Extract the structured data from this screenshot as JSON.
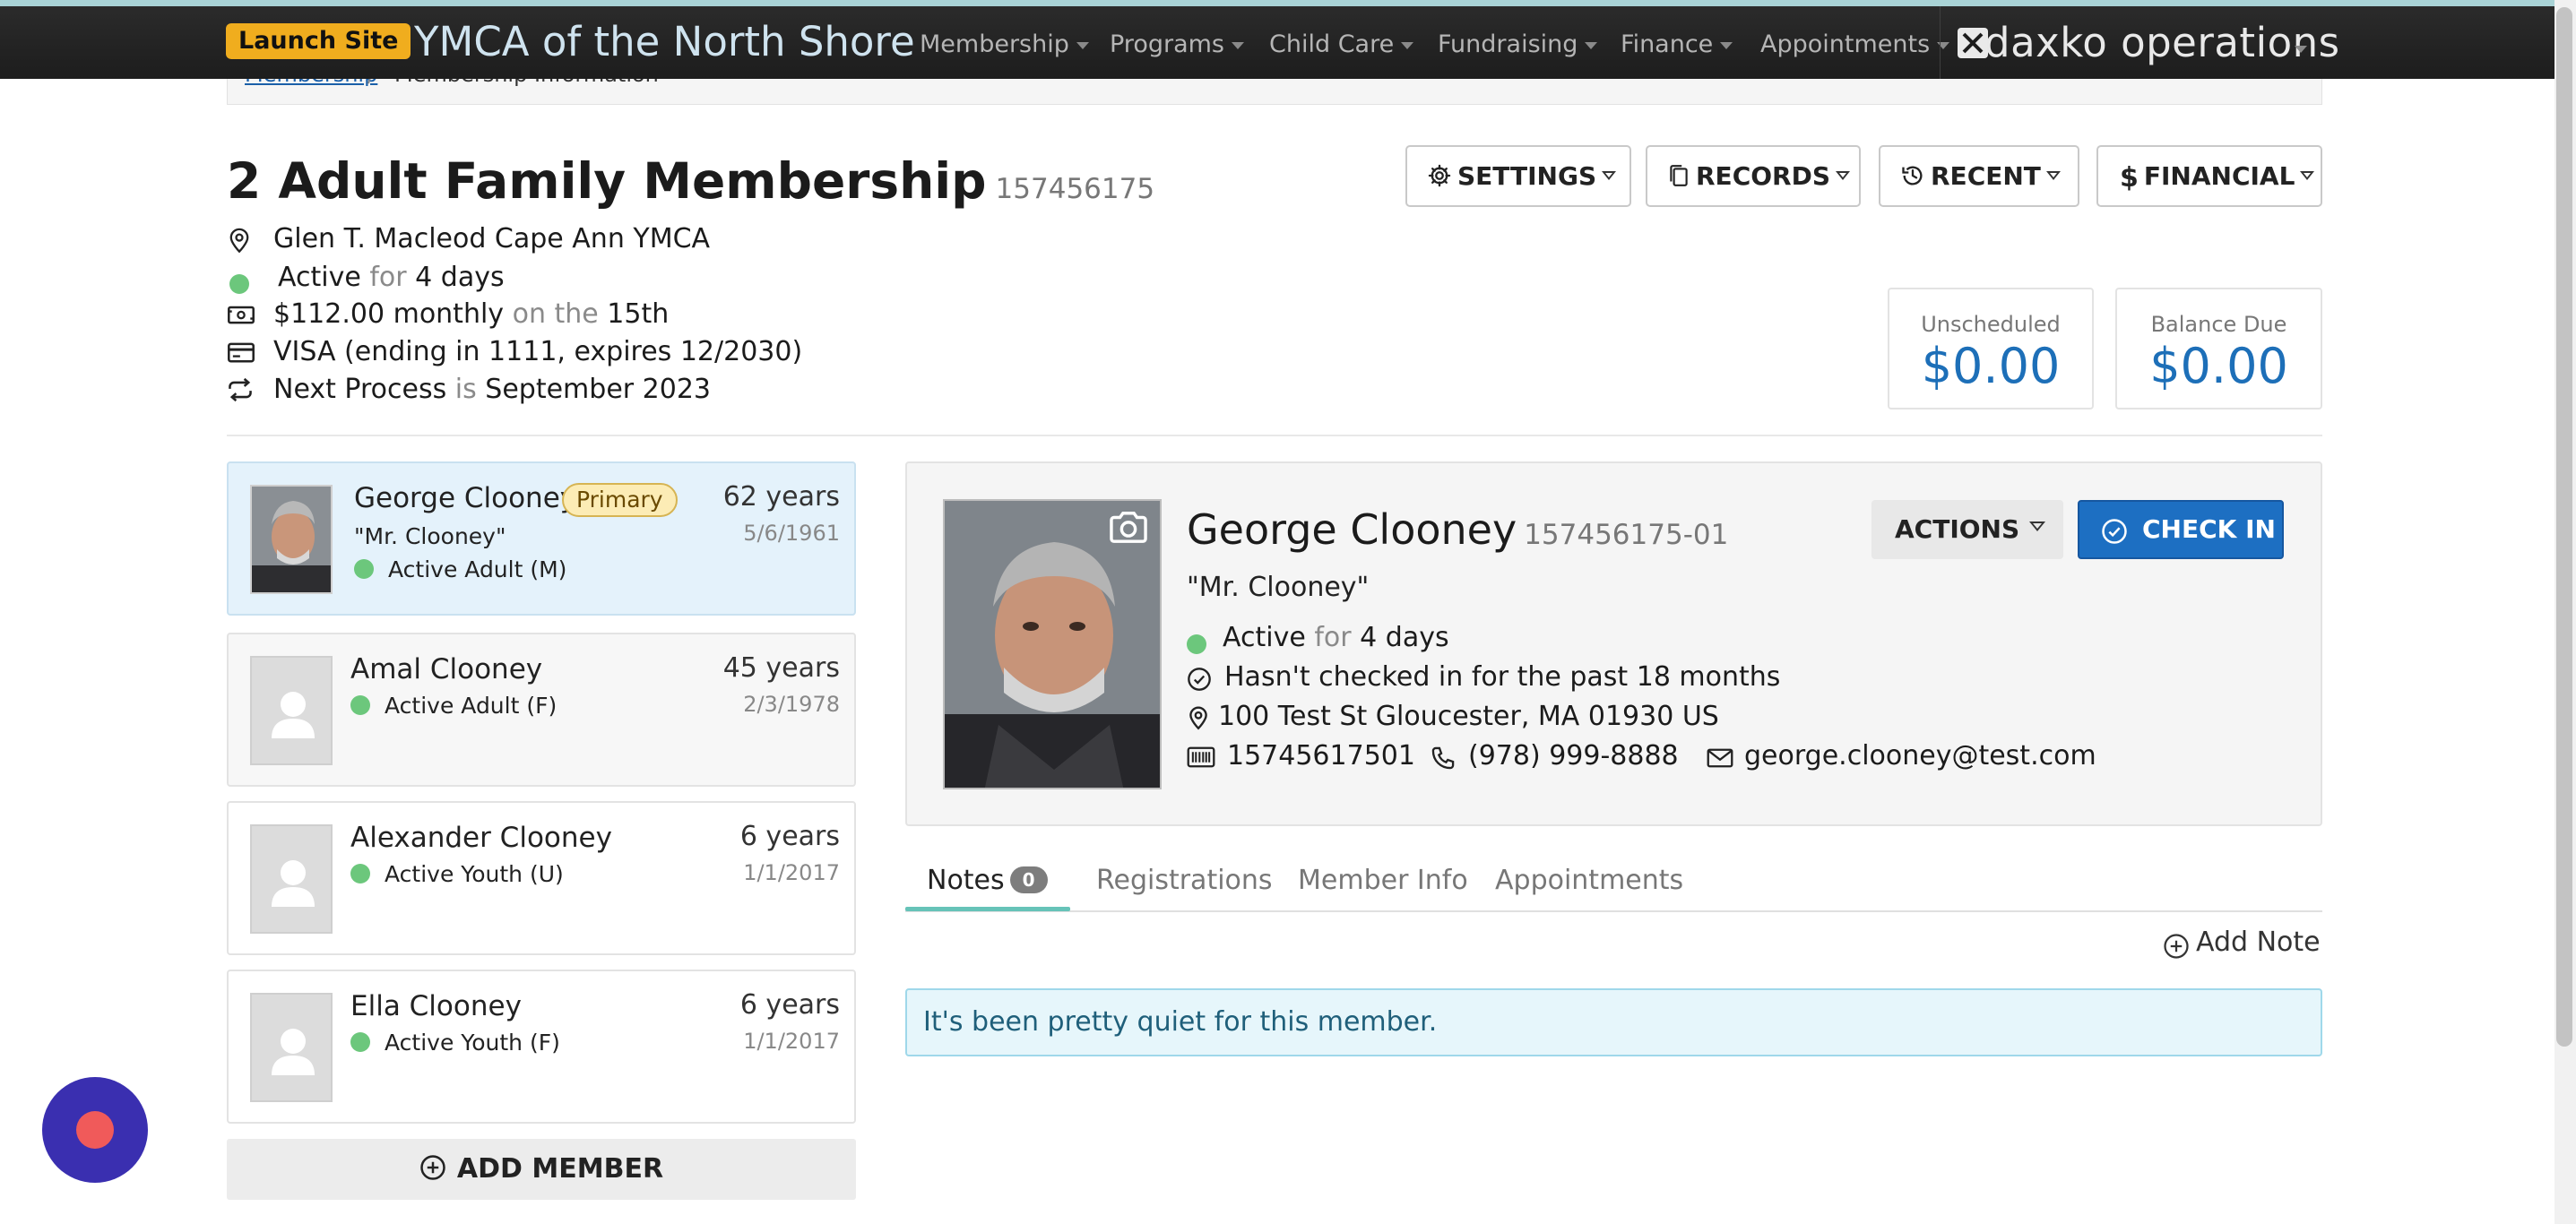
{
  "nav": {
    "launch_label": "Launch Site",
    "org_name": "YMCA of the North Shore",
    "menu": [
      "Membership",
      "Programs",
      "Child Care",
      "Fundraising",
      "Finance",
      "Appointments"
    ],
    "brand": "daxko operations"
  },
  "breadcrumb": {
    "link": "Membership",
    "separator": "/",
    "current": "Membership Information"
  },
  "membership": {
    "title": "2 Adult Family Membership",
    "id": "157456175",
    "branch": "Glen T. Macleod Cape Ann YMCA",
    "status": "Active",
    "status_for": "for",
    "status_duration": "4 days",
    "billing_amount": "$112.00 monthly",
    "billing_on": "on the",
    "billing_day": "15th",
    "payment_method": "VISA (ending in 1111, expires 12/2030)",
    "next_process_label": "Next Process",
    "next_process_is": "is",
    "next_process_date": "September 2023"
  },
  "header_buttons": {
    "settings": "SETTINGS",
    "records": "RECORDS",
    "recent": "RECENT",
    "financial": "FINANCIAL"
  },
  "stats": {
    "unscheduled_label": "Unscheduled",
    "unscheduled_value": "$0.00",
    "balance_label": "Balance Due",
    "balance_value": "$0.00"
  },
  "members": [
    {
      "name": "George Clooney",
      "badge": "Primary",
      "nickname": "\"Mr. Clooney\"",
      "status": "Active Adult (M)",
      "age": "62 years",
      "dob": "5/6/1961",
      "selected": true
    },
    {
      "name": "Amal Clooney",
      "status": "Active Adult (F)",
      "age": "45 years",
      "dob": "2/3/1978"
    },
    {
      "name": "Alexander Clooney",
      "status": "Active Youth (U)",
      "age": "6 years",
      "dob": "1/1/2017"
    },
    {
      "name": "Ella Clooney",
      "status": "Active Youth (F)",
      "age": "6 years",
      "dob": "1/1/2017"
    }
  ],
  "add_member_label": "ADD MEMBER",
  "detail": {
    "name": "George Clooney",
    "member_id": "157456175-01",
    "nickname": "\"Mr. Clooney\"",
    "status": "Active",
    "status_for": "for",
    "status_duration": "4 days",
    "checkin_note": "Hasn't checked in for the past 18 months",
    "address": "100 Test St Gloucester, MA 01930 US",
    "barcode": "15745617501",
    "phone": "(978) 999-8888",
    "email": "george.clooney@test.com",
    "actions_label": "ACTIONS",
    "checkin_label": "CHECK IN"
  },
  "tabs": [
    {
      "label": "Notes",
      "count": "0",
      "active": true
    },
    {
      "label": "Registrations"
    },
    {
      "label": "Member Info"
    },
    {
      "label": "Appointments"
    }
  ],
  "add_note_label": "Add Note",
  "notes_empty_message": "It's been pretty quiet for this member.",
  "colors": {
    "accent_blue": "#1d6fc2",
    "status_green": "#6cc77c",
    "launch_orange": "#f0ad1e",
    "tab_underline": "#66c3b8",
    "chat_purple": "#3a2fb0"
  }
}
